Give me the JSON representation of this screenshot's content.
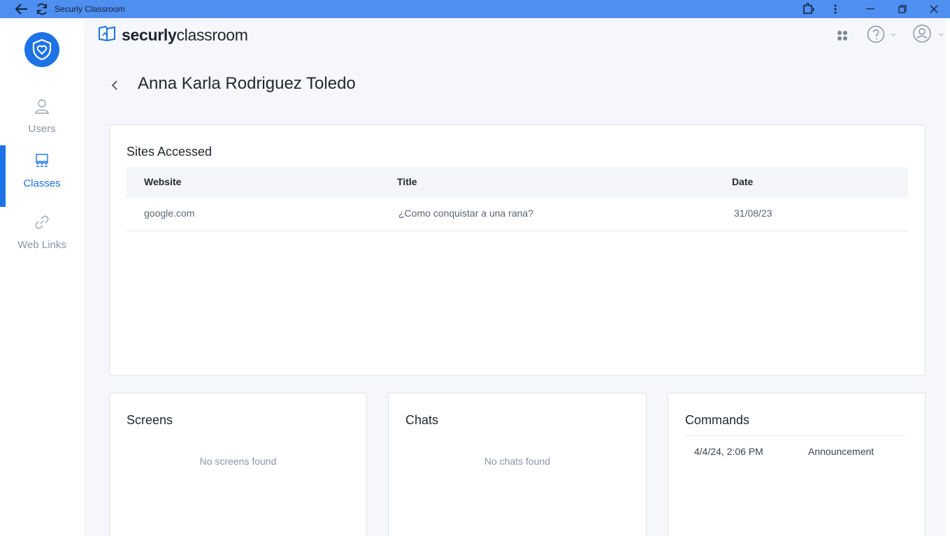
{
  "window": {
    "title": "Securly Classroom"
  },
  "sidebar": {
    "items": [
      {
        "label": "Users",
        "icon": "user-icon"
      },
      {
        "label": "Classes",
        "icon": "classes-icon",
        "active": true
      },
      {
        "label": "Web Links",
        "icon": "link-icon"
      }
    ]
  },
  "header": {
    "brand_bold": "securly",
    "brand_light": "classroom"
  },
  "page": {
    "title": "Anna Karla Rodriguez Toledo"
  },
  "sites_accessed": {
    "title": "Sites Accessed",
    "columns": [
      "Website",
      "Title",
      "Date"
    ],
    "rows": [
      {
        "website": "google.com",
        "title": "¿Como conquistar a una rana?",
        "date": "31/08/23"
      }
    ]
  },
  "screens": {
    "title": "Screens",
    "empty": "No screens found"
  },
  "chats": {
    "title": "Chats",
    "empty": "No chats found"
  },
  "commands": {
    "title": "Commands",
    "rows": [
      {
        "time": "4/4/24, 2:06 PM",
        "type": "Announcement"
      }
    ]
  },
  "colors": {
    "accent": "#1d72e6",
    "titlebar": "#4f8ff0"
  }
}
